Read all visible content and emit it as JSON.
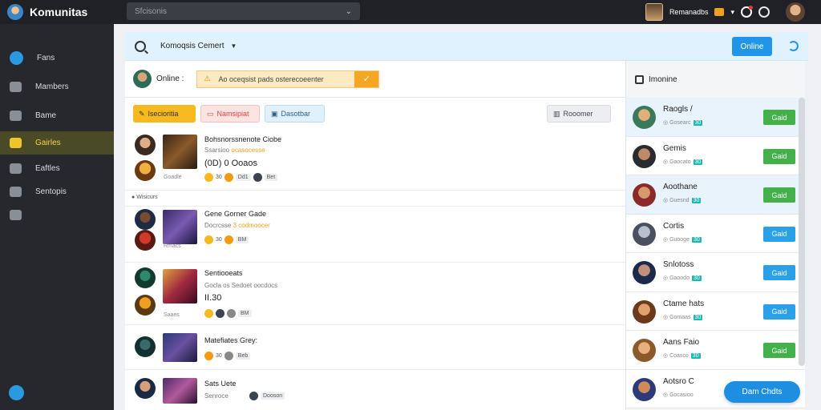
{
  "app": {
    "title": "Komunitas"
  },
  "topbar": {
    "search_placeholder": "Sfcisonis",
    "user_name": "Remanadbs"
  },
  "sidebar": {
    "items": [
      {
        "label": "Fans",
        "icon": "chat-bubble-icon"
      },
      {
        "label": "Mambers",
        "icon": "members-icon"
      },
      {
        "label": "Bame",
        "icon": "game-icon"
      },
      {
        "label": "Gairles",
        "icon": "gallery-icon",
        "active": true
      },
      {
        "label": "Eaftles",
        "icon": "settings-icon"
      },
      {
        "label": "Sentopis",
        "icon": "topics-icon"
      },
      {
        "label": "",
        "icon": "briefcase-icon"
      }
    ]
  },
  "header": {
    "title": "Komoqsis Cemert",
    "online_button": "Online"
  },
  "composer": {
    "label": "Online :",
    "banner_text": "Ao oceqsist pads osterecoeenter"
  },
  "filters": {
    "chips": [
      "Isecioritia",
      "Namsipiat",
      "Dasotbar"
    ],
    "right_chip": "Rooomer"
  },
  "posts": [
    {
      "title": "Bohsnorssnenote Ciobe",
      "meta": "Ssarsioo",
      "meta_hl": "ocasocesse",
      "big": "(0D) 0 Ooaos",
      "small": "Goadle",
      "reactions": [
        "30",
        "Dd1",
        "Bet"
      ]
    },
    {
      "title": "Gene Gorner Gade",
      "meta": "Docrcsse",
      "meta_hl": "3 codmoocer",
      "big": "",
      "small": "Rmacs",
      "reactions": [
        "30",
        "BM"
      ]
    },
    {
      "title": "Sentiooeats",
      "meta": "Gocla os Sedoet oocdocs",
      "meta_hl": "",
      "big": "II.30",
      "small": "Saaes",
      "reactions": [
        "BM"
      ]
    },
    {
      "title": "Matefiates Grey:",
      "meta": "",
      "meta_hl": "",
      "big": "",
      "small": "",
      "reactions": [
        "30",
        "Beb"
      ]
    },
    {
      "title": "Sats Uete",
      "meta": "Senroce",
      "meta_hl": "",
      "big": "",
      "small": "",
      "reactions": [
        "Dooson"
      ]
    }
  ],
  "divider": "Wisicurs",
  "online_panel": {
    "title": "Imonine",
    "friends": [
      {
        "name": "Raogls /",
        "status": "Gosearc",
        "count": "30",
        "button": "Gaid",
        "color": "green"
      },
      {
        "name": "Gemis",
        "status": "Gaocato",
        "count": "30",
        "button": "Gaid",
        "color": "green"
      },
      {
        "name": "Aoothane",
        "status": "Guesnd",
        "count": "30",
        "button": "Gaid",
        "color": "green"
      },
      {
        "name": "Cortis",
        "status": "Guooge",
        "count": "30",
        "button": "Gaid",
        "color": "blue"
      },
      {
        "name": "Snlotoss",
        "status": "Gaoodo",
        "count": "30",
        "button": "Gaid",
        "color": "blue"
      },
      {
        "name": "Ctame hats",
        "status": "Gomaas",
        "count": "30",
        "button": "Gaid",
        "color": "blue"
      },
      {
        "name": "Aans Faio",
        "status": "Coasco",
        "count": "30",
        "button": "Gaid",
        "color": "green"
      },
      {
        "name": "Aotsro C",
        "status": "Gocasioo",
        "count": "",
        "button": "",
        "color": ""
      }
    ],
    "float_button": "Dam Chdts"
  }
}
